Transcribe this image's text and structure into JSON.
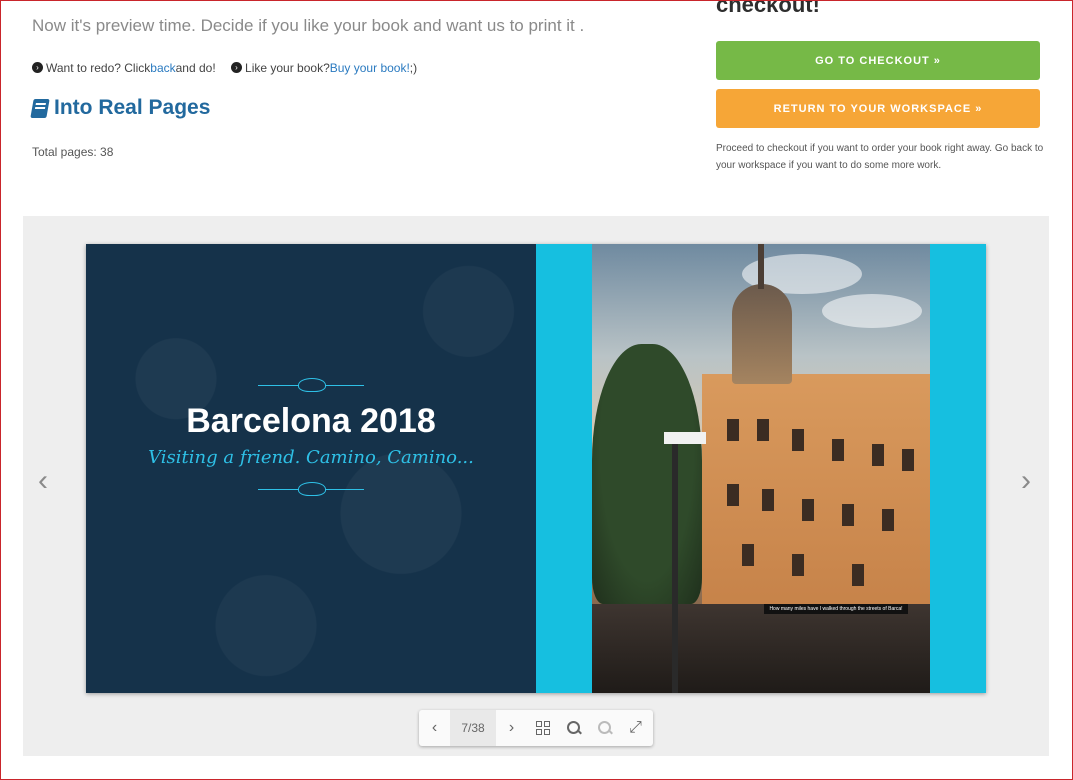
{
  "header": {
    "intro": "Now it's preview time. Decide if you like your book and want us to print it .",
    "redo_prefix": "Want to redo? Click ",
    "redo_link": "back",
    "redo_suffix": " and do!",
    "like_prefix": "Like your book? ",
    "like_link": "Buy your book!",
    "like_suffix": " ;)",
    "section_title": "Into Real Pages",
    "total_pages": "Total pages: 38"
  },
  "checkout": {
    "heading": "checkout!",
    "go_to_checkout": "GO TO CHECKOUT »",
    "return_workspace": "RETURN TO YOUR WORKSPACE »",
    "note": "Proceed to checkout if you want to order your book right away. Go back to your workspace if you want to do some more work."
  },
  "viewer": {
    "cover_title": "Barcelona 2018",
    "cover_subtitle": "Visiting a friend. Camino, Camino...",
    "photo_caption": "How many miles have I walked through the streets of Barca!",
    "page_counter": "7/38"
  },
  "colors": {
    "accent_blue": "#22699e",
    "green": "#76b947",
    "orange": "#f6a637",
    "cover_navy": "#15324a",
    "cyan": "#16bfe0"
  }
}
